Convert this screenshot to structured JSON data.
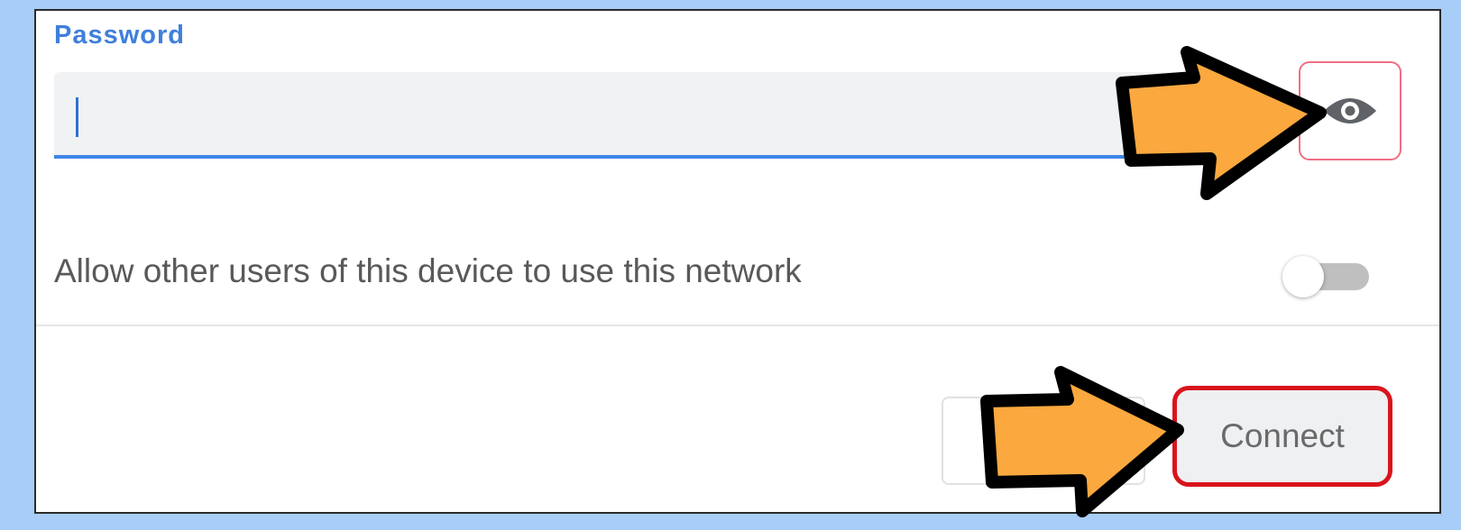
{
  "password": {
    "label": "Password",
    "value": "",
    "placeholder": "",
    "show_password_icon": "eye-icon"
  },
  "share_network": {
    "label": "Allow other users of this device to use this network",
    "enabled": false
  },
  "actions": {
    "cancel_label": "",
    "connect_label": "Connect"
  },
  "annotations": {
    "arrow_color": "#fba83f",
    "highlight_color": "#d9141c",
    "arrow_icon": "arrow-right-icon"
  },
  "colors": {
    "accent": "#3f86e8",
    "background": "#a8cdf6"
  }
}
